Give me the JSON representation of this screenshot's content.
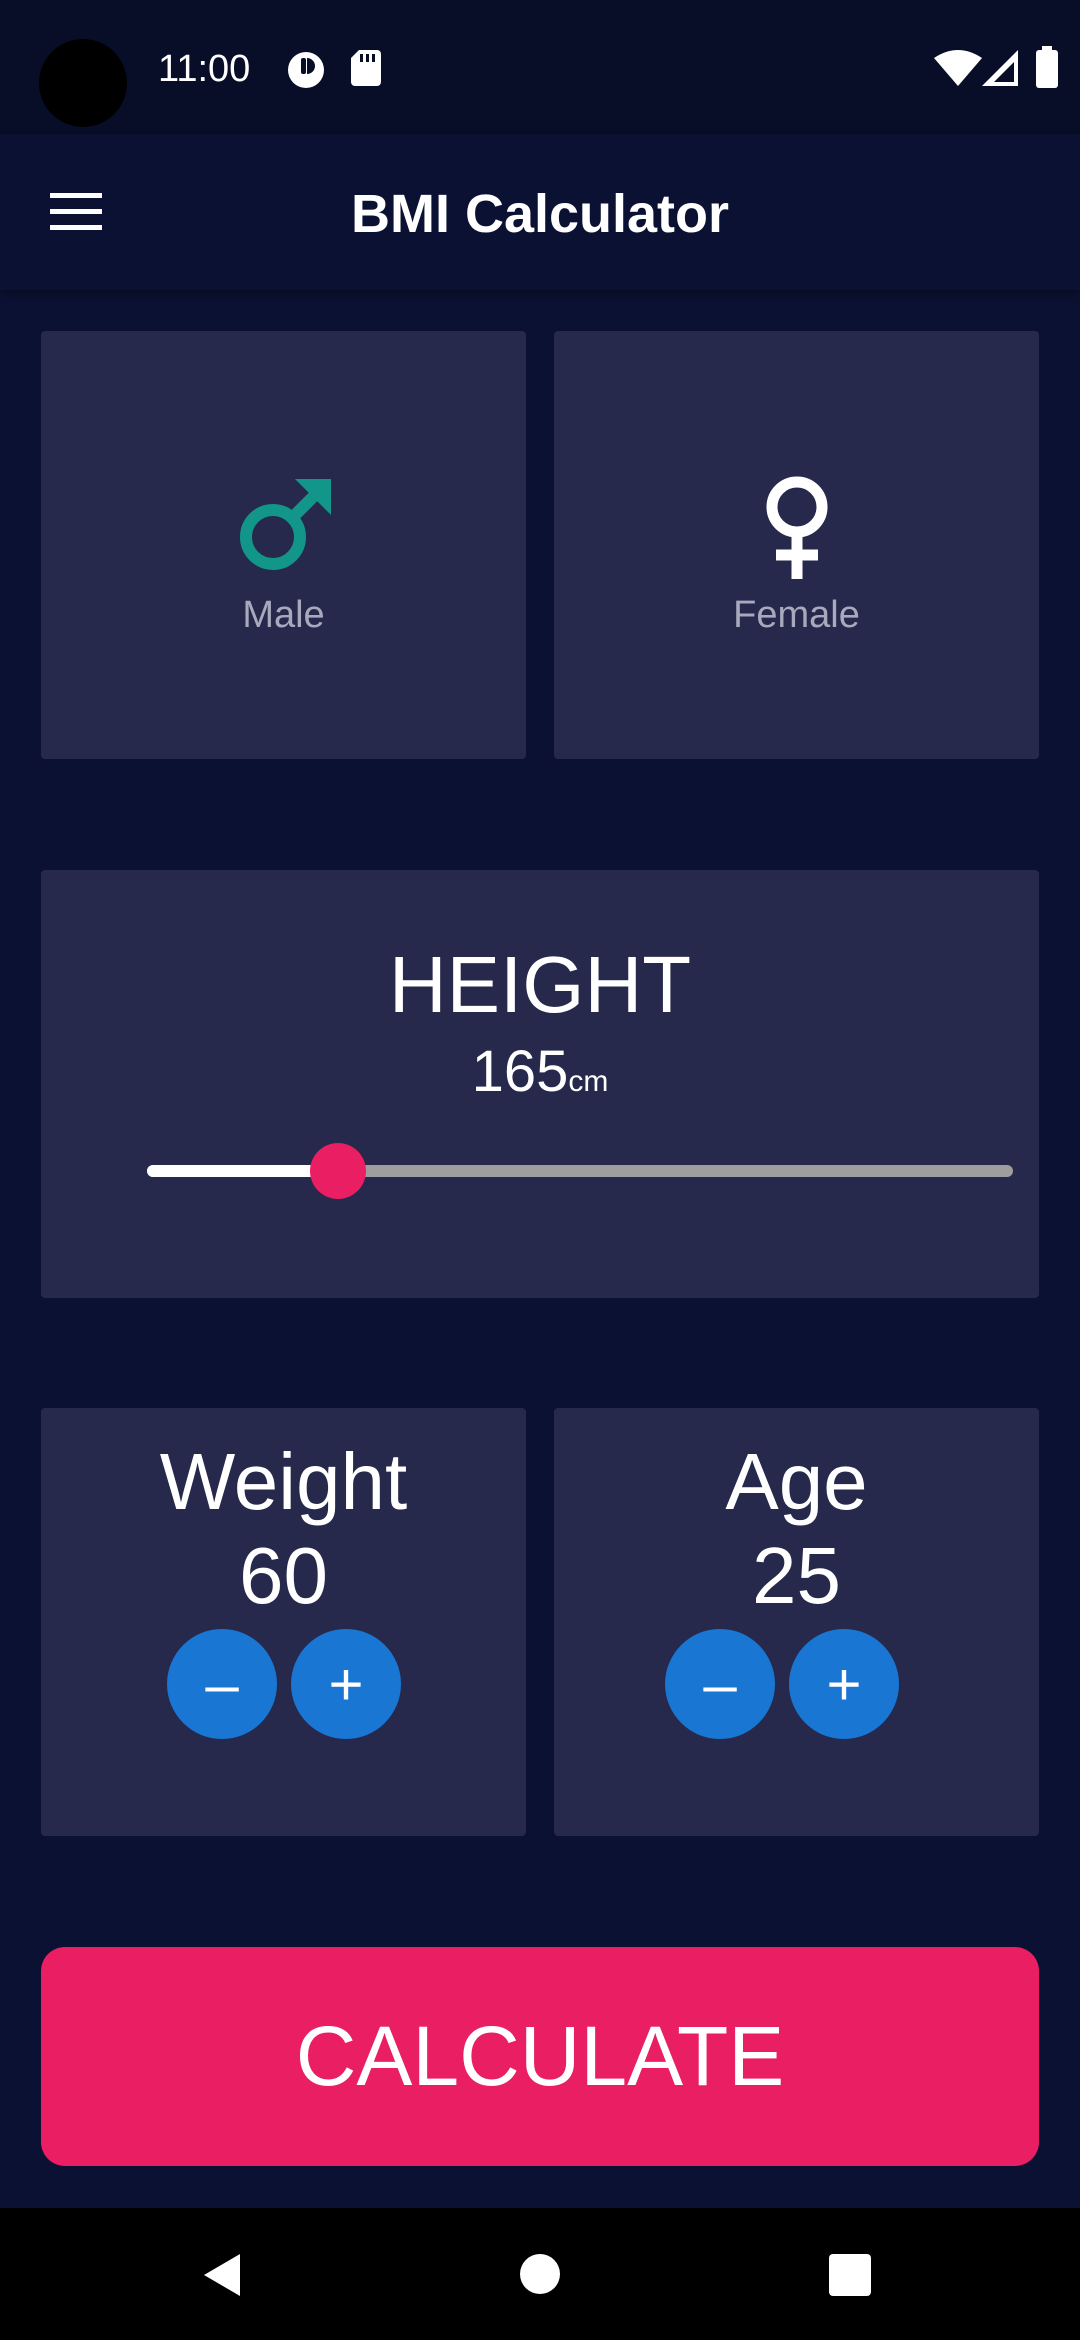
{
  "status_bar": {
    "time": "11:00",
    "icons": [
      "camera-cutout",
      "privacy-indicator-icon",
      "sd-card-icon",
      "wifi-icon",
      "signal-icon",
      "battery-icon"
    ]
  },
  "app_bar": {
    "title": "BMI Calculator",
    "menu_icon": "hamburger-menu-icon"
  },
  "gender": {
    "male": {
      "label": "Male",
      "icon": "male-symbol-icon",
      "color": "#12968a",
      "selected": true
    },
    "female": {
      "label": "Female",
      "icon": "female-symbol-icon",
      "color": "#ffffff",
      "selected": false
    }
  },
  "height": {
    "title": "HEIGHT",
    "value": "165",
    "unit": "cm",
    "slider_fraction": 0.22
  },
  "weight": {
    "title": "Weight",
    "value": "60",
    "minus_label": "–",
    "plus_label": "+"
  },
  "age": {
    "title": "Age",
    "value": "25",
    "minus_label": "–",
    "plus_label": "+"
  },
  "calculate": {
    "label": "CALCULATE"
  },
  "nav_bar": {
    "icons": [
      "back-icon",
      "home-icon",
      "recents-icon"
    ]
  },
  "colors": {
    "background": "#0b1133",
    "card": "#26284c",
    "accent": "#e91e63",
    "button_blue": "#1976d2",
    "male_teal": "#12968a"
  }
}
